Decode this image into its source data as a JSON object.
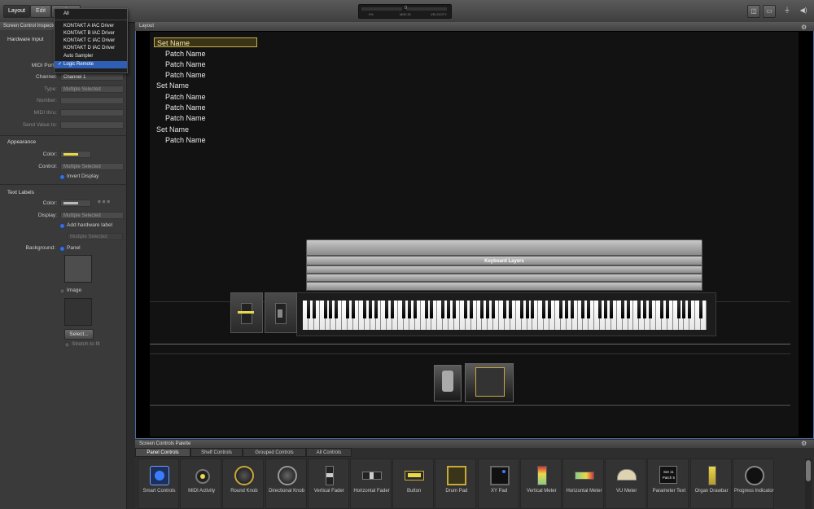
{
  "toolbar": {
    "tabs": [
      "Layout",
      "Edit",
      "Perform"
    ],
    "lcd": {
      "left": "0%",
      "mid": "MIDI IN",
      "right": "VELOCITY",
      "right_value": "0"
    }
  },
  "menu": {
    "items": [
      "All",
      "KONTAKT A IAC Driver",
      "KONTAKT B IAC Driver",
      "KONTAKT C IAC Driver",
      "KONTAKT D IAC Driver",
      "Auto Sampler",
      "Logic Remote"
    ],
    "selected": "Logic Remote",
    "check": "✓"
  },
  "inspector": {
    "header": "Screen Control Inspector",
    "hardware_input": "Hardware Input",
    "midi_port_label": "MIDI Port:",
    "channel_label": "Channel:",
    "channel_value": "Channel 1",
    "type_label": "Type:",
    "type_value": "Multiple Selected",
    "number_label": "Number:",
    "midi_thru_label": "MIDI thru:",
    "send_value_label": "Send Value to:",
    "appearance": "Appearance",
    "color_label": "Color:",
    "control_label": "Control:",
    "control_value": "Multiple Selected",
    "invert_display": "Invert Display",
    "text_labels": "Text Labels",
    "tl_color_label": "Color:",
    "display_label": "Display:",
    "display_value": "Multiple Selected",
    "add_hw_label": "Add hardware label",
    "multiple_selected": "Multiple Selected",
    "background_label": "Background:",
    "panel": "Panel",
    "image": "Image",
    "select_button": "Select...",
    "stretch": "Stretch to fit",
    "accent": "#e8d84a"
  },
  "layout": {
    "title": "Layout",
    "groups": [
      {
        "set": "Set Name",
        "patches": [
          "Patch Name",
          "Patch Name",
          "Patch Name"
        ]
      },
      {
        "set": "Set Name",
        "patches": [
          "Patch Name",
          "Patch Name",
          "Patch Name"
        ]
      },
      {
        "set": "Set Name",
        "patches": [
          "Patch Name"
        ]
      }
    ],
    "keyboard_layers_label": "Keyboard Layers"
  },
  "palette": {
    "title": "Screen Controls Palette",
    "tabs": [
      "Panel Controls",
      "Shelf Controls",
      "Grouped Controls",
      "All Controls"
    ],
    "items": [
      {
        "label": "Smart Controls",
        "icon": "smart-controls-icon"
      },
      {
        "label": "MIDI Activity",
        "icon": "midi-activity-icon"
      },
      {
        "label": "Round Knob",
        "icon": "round-knob-icon"
      },
      {
        "label": "Directional Knob",
        "icon": "directional-knob-icon"
      },
      {
        "label": "Vertical Fader",
        "icon": "vertical-fader-icon"
      },
      {
        "label": "Horizontal Fader",
        "icon": "horizontal-fader-icon"
      },
      {
        "label": "Button",
        "icon": "button-icon"
      },
      {
        "label": "Drum Pad",
        "icon": "drum-pad-icon"
      },
      {
        "label": "XY Pad",
        "icon": "xy-pad-icon"
      },
      {
        "label": "Vertical Meter",
        "icon": "vertical-meter-icon"
      },
      {
        "label": "Horizontal Meter",
        "icon": "horizontal-meter-icon"
      },
      {
        "label": "VU Meter",
        "icon": "vu-meter-icon"
      },
      {
        "label": "Parameter Text",
        "icon": "parameter-text-icon"
      },
      {
        "label": "Organ Drawbar",
        "icon": "organ-drawbar-icon"
      },
      {
        "label": "Progress Indicator",
        "icon": "progress-indicator-icon"
      }
    ],
    "param_text_icon": {
      "line1": "Set 11",
      "line2": "Patch 5"
    }
  }
}
